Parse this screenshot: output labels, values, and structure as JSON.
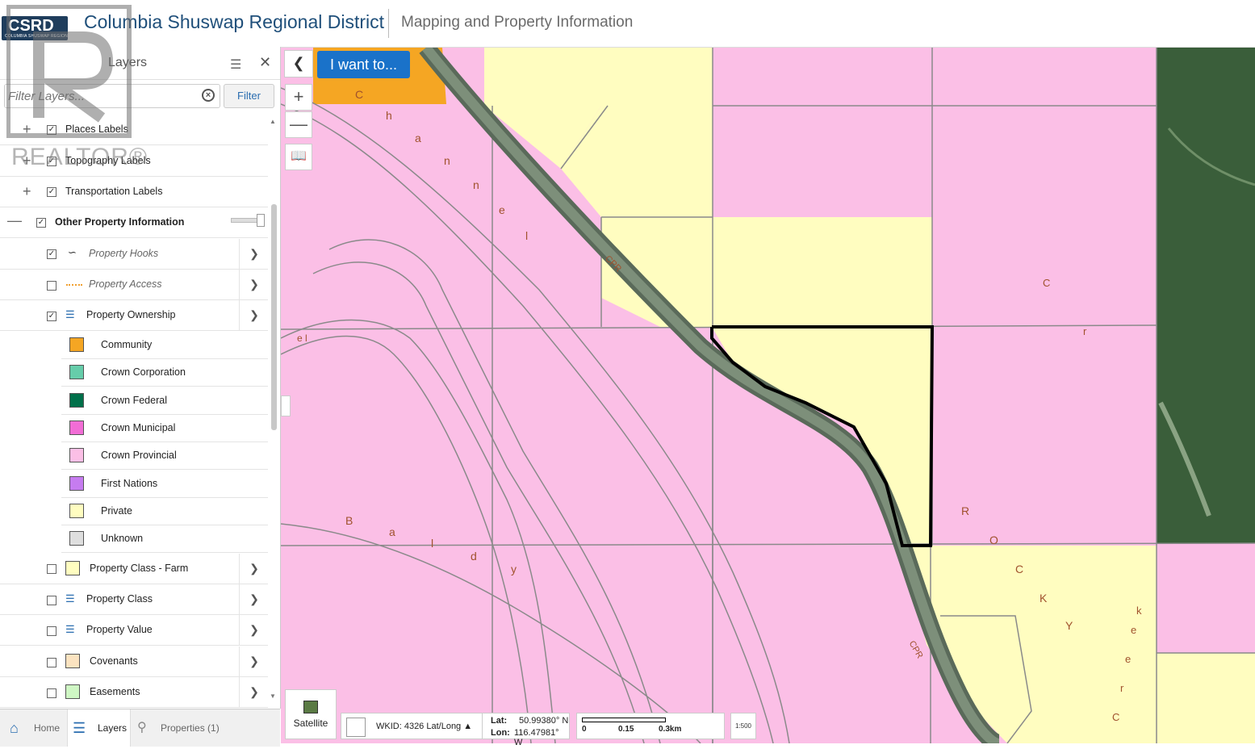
{
  "header": {
    "logo_text": "CSRD",
    "logo_subtext": "COLUMBIA SHUSWAP REGIONAL DISTRICT",
    "title": "Columbia Shuswap Regional District",
    "subtitle": "Mapping and Property Information"
  },
  "watermark": {
    "text": "REALTOR®"
  },
  "layers_panel": {
    "title": "Layers",
    "filter_placeholder": "Filter Layers...",
    "filter_button": "Filter",
    "items": [
      {
        "label": "Places Labels",
        "checked": true,
        "expandable": true
      },
      {
        "label": "Topography Labels",
        "checked": true,
        "expandable": true
      },
      {
        "label": "Transportation Labels",
        "checked": true,
        "expandable": true
      },
      {
        "label": "Other Property Information",
        "checked": true,
        "expanded": true
      },
      {
        "label": "Property Hooks",
        "checked": true,
        "icon": "line-symbol-icon"
      },
      {
        "label": "Property Access",
        "checked": false,
        "icon": "dashed-line-icon"
      },
      {
        "label": "Property Ownership",
        "checked": true,
        "icon": "legend-list-icon"
      },
      {
        "label": "Property Class - Farm",
        "checked": false
      },
      {
        "label": "Property Class",
        "checked": false,
        "icon": "legend-list-icon"
      },
      {
        "label": "Property Value",
        "checked": false,
        "icon": "legend-list-icon"
      },
      {
        "label": "Covenants",
        "checked": false
      },
      {
        "label": "Easements",
        "checked": false
      }
    ],
    "ownership_legend": [
      {
        "label": "Community",
        "color": "#f5a623"
      },
      {
        "label": "Crown Corporation",
        "color": "#66cdaa"
      },
      {
        "label": "Crown Federal",
        "color": "#00704a"
      },
      {
        "label": "Crown Municipal",
        "color": "#f26dd6"
      },
      {
        "label": "Crown Provincial",
        "color": "#fbbfe6"
      },
      {
        "label": "First Nations",
        "color": "#c67cf0"
      },
      {
        "label": "Private",
        "color": "#fffdc0"
      },
      {
        "label": "Unknown",
        "color": "#dedede"
      }
    ],
    "swatch_farm": "#fffdc0",
    "swatch_covenants": "#fbe3c0",
    "swatch_easements": "#cff7c4"
  },
  "bottom_tabs": {
    "home": "Home",
    "layers": "Layers",
    "properties": "Properties (1)"
  },
  "map": {
    "i_want_to": "I want to...",
    "basemap_button": "Satellite",
    "wkid_label": "WKID: 4326 Lat/Long ▲",
    "lat_label": "Lat:",
    "lat_value": "50.99380° N",
    "lon_label": "Lon:",
    "lon_value": "116.47981° W",
    "scale_ticks": [
      "0",
      "0.15",
      "0.3km"
    ],
    "scale_icon_text": "1:500",
    "labels": {
      "channel": [
        "C",
        "h",
        "a",
        "n",
        "n",
        "e",
        "l"
      ],
      "baldy": [
        "B",
        "a",
        "l",
        "d",
        "y"
      ],
      "rocky_creek": [
        "R",
        "O",
        "C",
        "K",
        "Y"
      ],
      "creek": [
        "C",
        "r",
        "e",
        "e",
        "k"
      ],
      "cr": [
        "C",
        "r"
      ],
      "cpr": "CPR",
      "el": "e l"
    },
    "colors": {
      "crown_provincial": "#fbbfe6",
      "private": "#fffdc0",
      "community": "#f5a623",
      "forest": "#3a5e3a"
    }
  }
}
